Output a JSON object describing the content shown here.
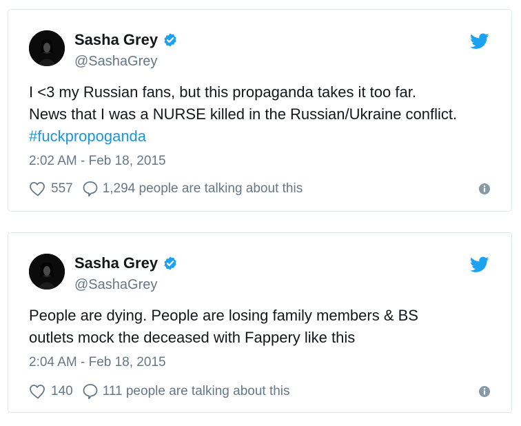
{
  "tweets": [
    {
      "name": "Sasha Grey",
      "handle": "@SashaGrey",
      "text_line1": "I <3 my Russian fans, but this propaganda takes it too far.",
      "text_line2": "News that I was a NURSE killed in the Russian/Ukraine conflict.",
      "hashtag": "#fuckpropoganda",
      "timestamp": "2:02 AM - Feb 18, 2015",
      "likes": "557",
      "talking": "1,294 people are talking about this"
    },
    {
      "name": "Sasha Grey",
      "handle": "@SashaGrey",
      "text_line1": "People are dying. People are losing family members & BS",
      "text_line2": "outlets mock the deceased with Fappery like this",
      "timestamp": "2:04 AM - Feb 18, 2015",
      "likes": "140",
      "talking": "111 people are talking about this"
    }
  ],
  "colors": {
    "link": "#1b95e0",
    "verified": "#1da1f2",
    "muted": "#657786",
    "border": "#e1e8ed"
  },
  "icons": [
    "avatar",
    "verified-badge-icon",
    "twitter-bird-icon",
    "heart-icon",
    "reply-bubble-icon",
    "info-icon"
  ]
}
